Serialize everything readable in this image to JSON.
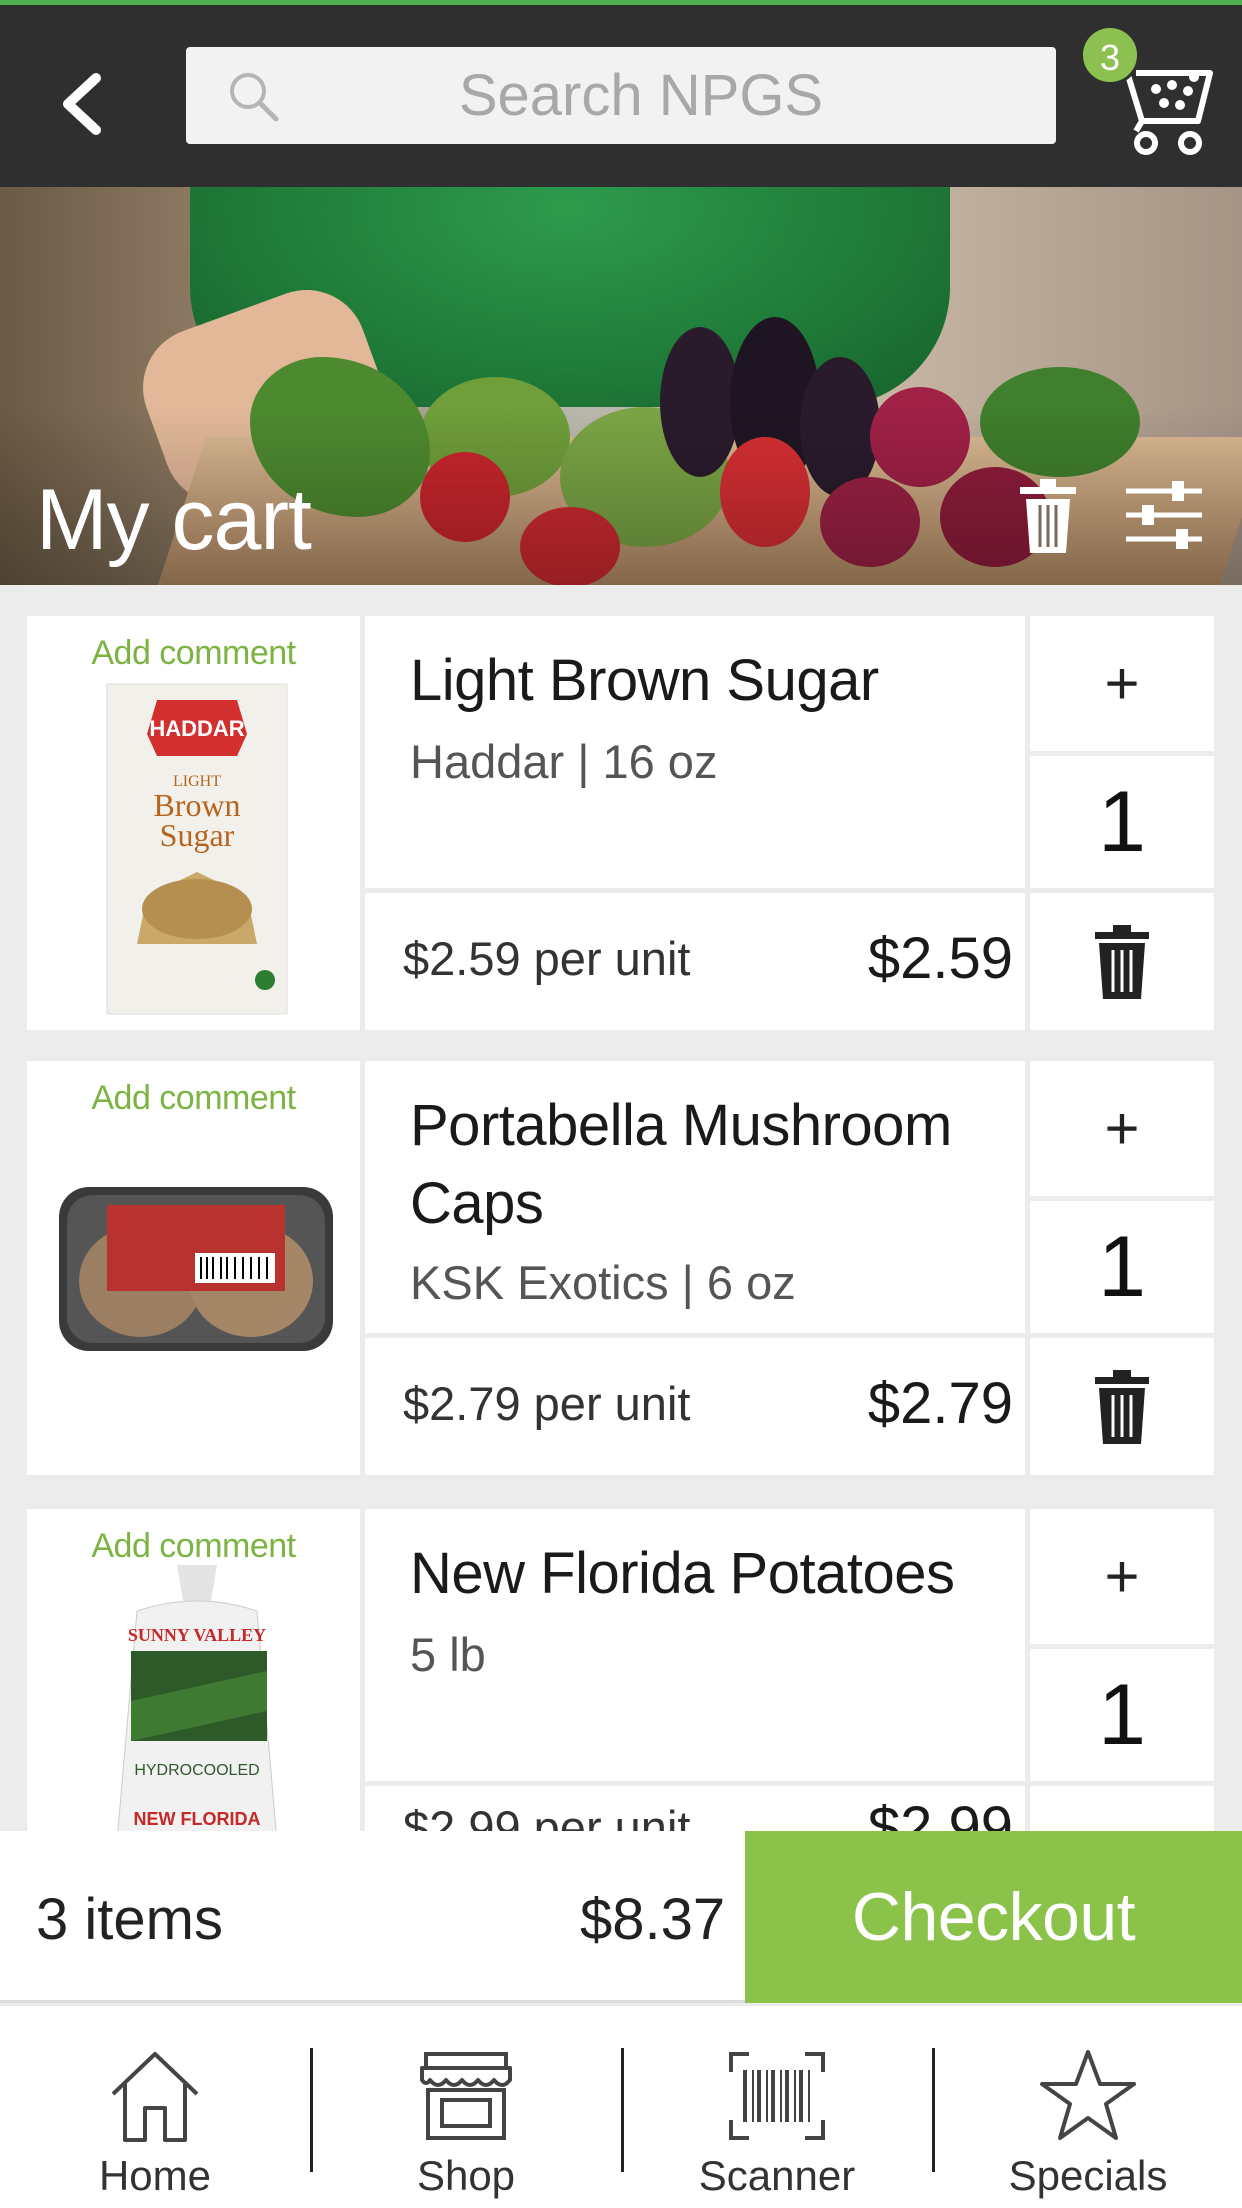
{
  "header": {
    "search_placeholder": "Search NPGS",
    "cart_count": "3"
  },
  "hero": {
    "title": "My cart"
  },
  "cart": {
    "items": [
      {
        "add_comment": "Add comment",
        "name": "Light Brown Sugar",
        "subtitle": "Haddar | 16 oz",
        "unit_price": "$2.59 per unit",
        "total": "$2.59",
        "plus": "+",
        "quantity": "1",
        "image_text": {
          "brand": "HADDAR",
          "line1": "LIGHT",
          "line2": "Brown",
          "line3": "Sugar"
        }
      },
      {
        "add_comment": "Add comment",
        "name": "Portabella Mushroom Caps",
        "subtitle": "KSK Exotics | 6 oz",
        "unit_price": "$2.79 per unit",
        "total": "$2.79",
        "plus": "+",
        "quantity": "1"
      },
      {
        "add_comment": "Add comment",
        "name": "New Florida Potatoes",
        "subtitle": "5 lb",
        "unit_price": "$2.99 per unit",
        "total": "$2.99",
        "plus": "+",
        "quantity": "1",
        "image_text": {
          "label": "HYDROCOOLED"
        }
      }
    ]
  },
  "summary": {
    "item_count": "3 items",
    "total": "$8.37",
    "checkout_label": "Checkout"
  },
  "nav": {
    "items": [
      {
        "label": "Home",
        "icon": "home-icon"
      },
      {
        "label": "Shop",
        "icon": "shop-icon"
      },
      {
        "label": "Scanner",
        "icon": "barcode-icon"
      },
      {
        "label": "Specials",
        "icon": "star-icon"
      }
    ]
  },
  "colors": {
    "topbar": "#2f2f2f",
    "accent_green": "#8bc34a",
    "comment_green": "#7cb342",
    "background": "#ececec"
  }
}
